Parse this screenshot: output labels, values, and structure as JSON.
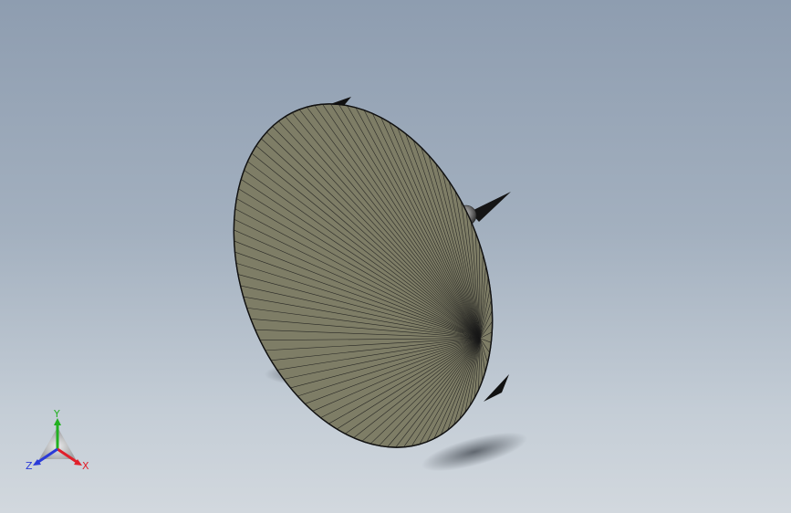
{
  "viewport": {
    "background_top": "#8e9db0",
    "background_bottom": "#d2d8de"
  },
  "model": {
    "dish_color": "#7e7d66",
    "edge_color": "#1a1a1a",
    "shadow_color": "#4a5058"
  },
  "triad": {
    "x_label": "X",
    "y_label": "Y",
    "z_label": "Z",
    "x_color": "#e0202a",
    "y_color": "#22b020",
    "z_color": "#2a3ad8"
  }
}
